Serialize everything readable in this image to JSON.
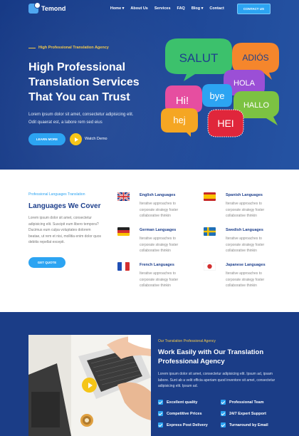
{
  "header": {
    "logo_text": "Temond",
    "menu": [
      "Home ▾",
      "About Us",
      "Services",
      "FAQ",
      "Blog ▾",
      "Contact"
    ],
    "contact_button": "CONTACT US"
  },
  "hero": {
    "tagline": "High Professional Translation Agency",
    "title": "High Professional Translation Services That You can Trust",
    "description": "Lorem ipsum dolor sit amet, consectetur adipisicing elit. Odit quaerat est, a labore rem sed eius",
    "learn_more": "LEARN MORE",
    "watch_demo": "Watch Demo",
    "bubble_words": [
      "SALUT",
      "ADIÓS",
      "HOLA",
      "bye",
      "Hi!",
      "HALLO",
      "hej",
      "HEI"
    ]
  },
  "languages": {
    "tag": "Professional Languages Translation",
    "title": "Languages We Cover",
    "description": "Lorem ipsum dolor sit amet, consectetur adipisicing elit. Suscipit eum libero tempora? Ducimus eum culpa voluptates dolorem beatae, ut rem et nisi, mollitia enim dolor quos debitis repellat excepti.",
    "quote_button": "GET QUOTE",
    "items": [
      {
        "name": "English Languages",
        "desc": "Iterative approaches to corporate strategy foster collaborative thinkin"
      },
      {
        "name": "Spanish Languages",
        "desc": "Iterative approaches to corporate strategy foster collaborative thinkin"
      },
      {
        "name": "German Languages",
        "desc": "Iterative approaches to corporate strategy foster collaborative thinkin"
      },
      {
        "name": "Swedish Languages",
        "desc": "Iterative approaches to corporate strategy foster collaborative thinkin"
      },
      {
        "name": "French Languages",
        "desc": "Iterative approaches to corporate strategy foster collaborative thinkin"
      },
      {
        "name": "Japanese Languages",
        "desc": "Iterative approaches to corporate strategy foster collaborative thinkin"
      }
    ]
  },
  "agency": {
    "tag": "Our Translation Professional Agency",
    "title": "Work Easily with Our Translation Professional Agency",
    "description": "Lorem ipsum dolor sit amet, consectetur adipisicing elit. Ipsum ad, ipsam labore. Sunt ab a velit officia aperiam quod inventore sit amet, consectetur adipisicing elit. Ipsum ad.",
    "features": [
      "Excellent quality",
      "Professional Team",
      "Competitive Prices",
      "24/7 Expert Support",
      "Express Post Delivery",
      "Turnaround by Email"
    ]
  },
  "colors": {
    "primary": "#1d3f8c",
    "accent": "#2ca4f2",
    "yellow": "#f2c94c"
  }
}
